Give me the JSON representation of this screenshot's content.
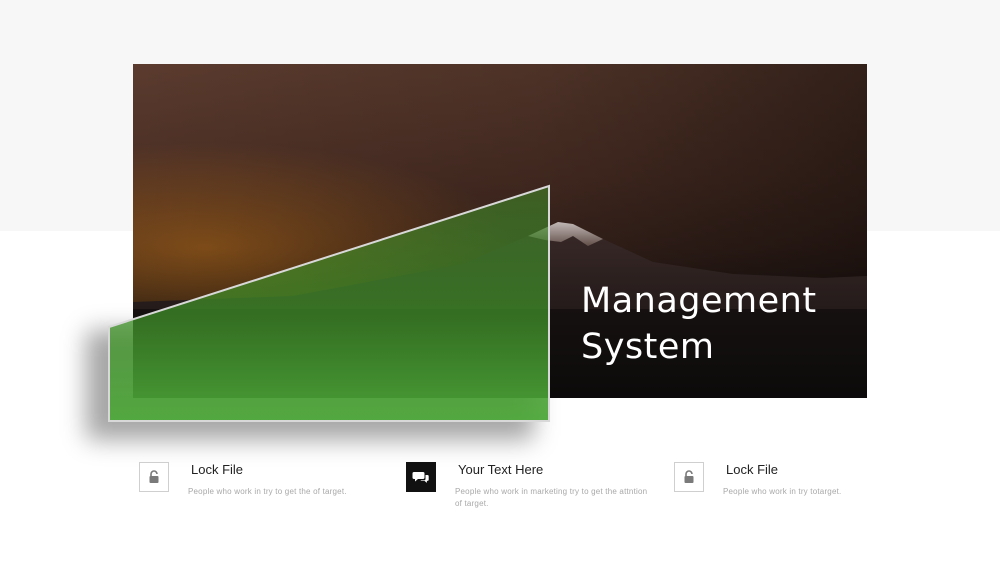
{
  "hero": {
    "title_line1": "Management",
    "title_line2": "System"
  },
  "features": [
    {
      "icon": "unlock-icon",
      "title": "Lock File",
      "text": "People who work in try to get the of target."
    },
    {
      "icon": "chat-icon",
      "title": "Your Text Here",
      "text": "People who work in marketing try to get the attntion of target."
    },
    {
      "icon": "unlock-icon",
      "title": "Lock File",
      "text": "People who work in try totarget."
    }
  ],
  "colors": {
    "accent_green": "#4a9a2c",
    "background_band": "#f7f7f7"
  }
}
